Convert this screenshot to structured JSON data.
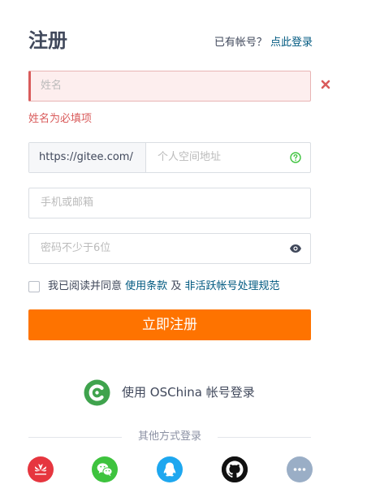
{
  "header": {
    "title": "注册",
    "have_account": "已有帐号？",
    "login_link": "点此登录"
  },
  "form": {
    "name": {
      "placeholder": "姓名",
      "error": "姓名为必填项"
    },
    "space": {
      "prefix": "https://gitee.com/",
      "placeholder": "个人空间地址"
    },
    "account": {
      "placeholder": "手机或邮箱"
    },
    "password": {
      "placeholder": "密码不少于6位"
    },
    "agreement": {
      "text": "我已阅读并同意",
      "terms_link": "使用条款",
      "and": "及",
      "policy_link": "非活跃帐号处理规范"
    },
    "submit_label": "立即注册"
  },
  "oschina": {
    "label": "使用 OSChina 帐号登录",
    "icon": "oschina-logo-icon"
  },
  "other_login": {
    "label": "其他方式登录",
    "providers": [
      {
        "name": "huawei",
        "icon": "huawei-icon",
        "color": "#e6363f"
      },
      {
        "name": "wechat",
        "icon": "wechat-icon",
        "color": "#3ec33e"
      },
      {
        "name": "qq",
        "icon": "qq-icon",
        "color": "#1ea7ef"
      },
      {
        "name": "github",
        "icon": "github-icon",
        "color": "#111111"
      },
      {
        "name": "more",
        "icon": "more-icon",
        "color": "#9aaec6"
      }
    ]
  },
  "colors": {
    "accent": "#fe7300",
    "link": "#005980",
    "error": "#d95b5b"
  }
}
